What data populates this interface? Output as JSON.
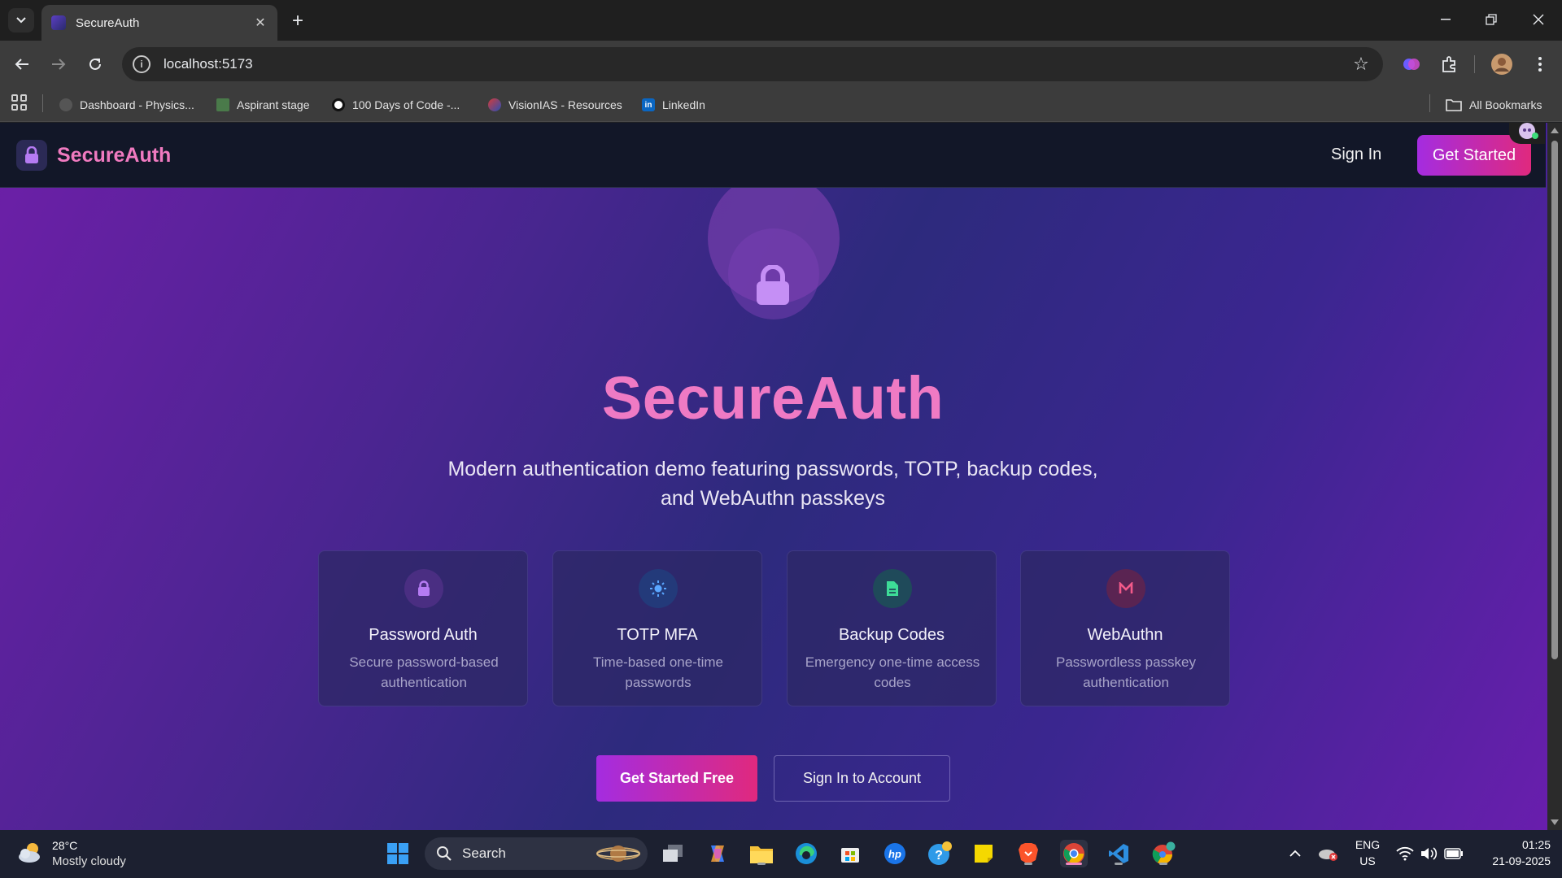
{
  "browser": {
    "tab_title": "SecureAuth",
    "url": "localhost:5173",
    "bookmarks": [
      {
        "label": "Dashboard - Physics...",
        "color": "#555555"
      },
      {
        "label": "Aspirant stage",
        "color": "#4a7a4a"
      },
      {
        "label": "100 Days of Code -...",
        "color": "#ffffff"
      },
      {
        "label": "VisionIAS - Resources",
        "color": "#d33b3b"
      },
      {
        "label": "LinkedIn",
        "color": "#0a66c2"
      }
    ],
    "all_bookmarks": "All Bookmarks"
  },
  "header": {
    "logo": "SecureAuth",
    "sign_in": "Sign In",
    "get_started": "Get Started"
  },
  "hero": {
    "title": "SecureAuth",
    "subtitle": "Modern authentication demo featuring passwords, TOTP, backup codes, and WebAuthn passkeys"
  },
  "features": [
    {
      "title": "Password Auth",
      "desc": "Secure password-based authentication",
      "icon": "lock-icon",
      "color": "#b57bf2"
    },
    {
      "title": "TOTP MFA",
      "desc": "Time-based one-time passwords",
      "icon": "sun-icon",
      "color": "#5aa6ff"
    },
    {
      "title": "Backup Codes",
      "desc": "Emergency one-time access codes",
      "icon": "document-icon",
      "color": "#3ddc97"
    },
    {
      "title": "WebAuthn",
      "desc": "Passwordless passkey authentication",
      "icon": "passkey-icon",
      "color": "#f25a8a"
    }
  ],
  "cta": {
    "primary": "Get Started Free",
    "secondary": "Sign In to Account"
  },
  "taskbar": {
    "temperature": "28°C",
    "weather": "Mostly cloudy",
    "search": "Search",
    "lang": "ENG",
    "region": "US",
    "time": "01:25",
    "date": "21-09-2025"
  }
}
